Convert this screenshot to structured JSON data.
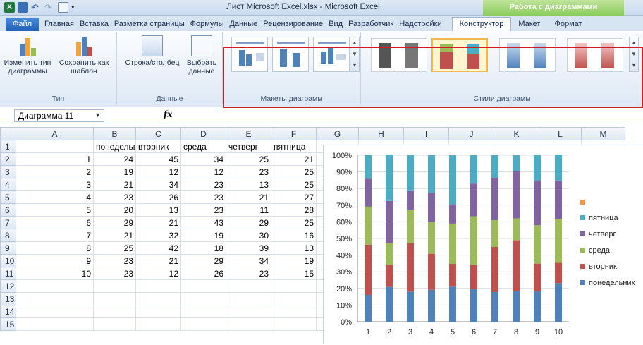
{
  "titlebar": {
    "title": "Лист Microsoft Excel.xlsx - Microsoft Excel",
    "context_label": "Работа с диаграммами"
  },
  "tabs": [
    "Файл",
    "Главная",
    "Вставка",
    "Разметка страницы",
    "Формулы",
    "Данные",
    "Рецензирование",
    "Вид",
    "Разработчик",
    "Надстройки",
    "Конструктор",
    "Макет",
    "Формат"
  ],
  "ribbon": {
    "change_type": "Изменить тип диаграммы",
    "save_template": "Сохранить как шаблон",
    "group_type": "Тип",
    "row_col": "Строка/столбец",
    "select_data": "Выбрать данные",
    "group_data": "Данные",
    "group_layouts": "Макеты диаграмм",
    "group_styles": "Стили диаграмм"
  },
  "formula_bar": {
    "name_box": "Диаграмма 11",
    "fx": "fx",
    "value": ""
  },
  "sheet": {
    "columns": [
      "A",
      "B",
      "C",
      "D",
      "E",
      "F",
      "G",
      "H",
      "I",
      "J",
      "K",
      "L",
      "M"
    ],
    "rows": [
      {
        "n": "1",
        "cells": [
          "",
          "понедельник",
          "вторник",
          "среда",
          "четверг",
          "пятница"
        ]
      },
      {
        "n": "2",
        "cells": [
          "1",
          "24",
          "45",
          "34",
          "25",
          "21"
        ]
      },
      {
        "n": "3",
        "cells": [
          "2",
          "19",
          "12",
          "12",
          "23",
          "25"
        ]
      },
      {
        "n": "4",
        "cells": [
          "3",
          "21",
          "34",
          "23",
          "13",
          "25"
        ]
      },
      {
        "n": "5",
        "cells": [
          "4",
          "23",
          "26",
          "23",
          "21",
          "27"
        ]
      },
      {
        "n": "6",
        "cells": [
          "5",
          "20",
          "13",
          "23",
          "11",
          "28"
        ]
      },
      {
        "n": "7",
        "cells": [
          "6",
          "29",
          "21",
          "43",
          "29",
          "25"
        ]
      },
      {
        "n": "8",
        "cells": [
          "7",
          "21",
          "32",
          "19",
          "30",
          "16"
        ]
      },
      {
        "n": "9",
        "cells": [
          "8",
          "25",
          "42",
          "18",
          "39",
          "13"
        ]
      },
      {
        "n": "10",
        "cells": [
          "9",
          "23",
          "21",
          "29",
          "34",
          "19"
        ]
      },
      {
        "n": "11",
        "cells": [
          "10",
          "23",
          "12",
          "26",
          "23",
          "15"
        ]
      },
      {
        "n": "12",
        "cells": [
          "",
          "",
          "",
          "",
          "",
          ""
        ]
      },
      {
        "n": "13",
        "cells": [
          "",
          "",
          "",
          "",
          "",
          ""
        ]
      },
      {
        "n": "14",
        "cells": [
          "",
          "",
          "",
          "",
          "",
          ""
        ]
      },
      {
        "n": "15",
        "cells": [
          "",
          "",
          "",
          "",
          "",
          ""
        ]
      }
    ]
  },
  "chart_data": {
    "type": "bar",
    "stacked_percent": true,
    "categories": [
      "1",
      "2",
      "3",
      "4",
      "5",
      "6",
      "7",
      "8",
      "9",
      "10"
    ],
    "series": [
      {
        "name": "понедельник",
        "color": "#4f81bd",
        "values": [
          24,
          19,
          21,
          23,
          20,
          29,
          21,
          25,
          23,
          23
        ]
      },
      {
        "name": "вторник",
        "color": "#c0504d",
        "values": [
          45,
          12,
          34,
          26,
          13,
          21,
          32,
          42,
          21,
          12
        ]
      },
      {
        "name": "среда",
        "color": "#9bbb59",
        "values": [
          34,
          12,
          23,
          23,
          23,
          43,
          19,
          18,
          29,
          26
        ]
      },
      {
        "name": "четверг",
        "color": "#8064a2",
        "values": [
          25,
          23,
          13,
          21,
          11,
          29,
          30,
          39,
          34,
          23
        ]
      },
      {
        "name": "пятница",
        "color": "#4bacc6",
        "values": [
          21,
          25,
          25,
          27,
          28,
          25,
          16,
          13,
          19,
          15
        ]
      }
    ],
    "y_ticks": [
      "0%",
      "10%",
      "20%",
      "30%",
      "40%",
      "50%",
      "60%",
      "70%",
      "80%",
      "90%",
      "100%"
    ],
    "ylim": [
      0,
      100
    ],
    "legend_position": "right",
    "legend_extra_color": "#f79646"
  }
}
